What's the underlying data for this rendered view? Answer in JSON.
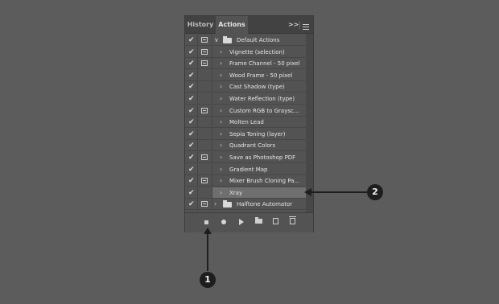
{
  "panel": {
    "tabs": [
      {
        "label": "History",
        "active": false
      },
      {
        "label": "Actions",
        "active": true
      }
    ],
    "expand_label": ">>"
  },
  "actions": [
    {
      "name": "Default Actions",
      "checked": true,
      "dialog": true,
      "type": "folder",
      "expanded": true
    },
    {
      "name": "Vignette (selection)",
      "checked": true,
      "dialog": true,
      "type": "action"
    },
    {
      "name": "Frame Channel - 50 pixel",
      "checked": true,
      "dialog": true,
      "type": "action"
    },
    {
      "name": "Wood Frame - 50 pixel",
      "checked": true,
      "dialog": false,
      "type": "action"
    },
    {
      "name": "Cast Shadow (type)",
      "checked": true,
      "dialog": false,
      "type": "action"
    },
    {
      "name": "Water Reflection (type)",
      "checked": true,
      "dialog": false,
      "type": "action"
    },
    {
      "name": "Custom RGB to Graysc...",
      "checked": true,
      "dialog": true,
      "type": "action"
    },
    {
      "name": "Molten Lead",
      "checked": true,
      "dialog": false,
      "type": "action"
    },
    {
      "name": "Sepia Toning (layer)",
      "checked": true,
      "dialog": false,
      "type": "action"
    },
    {
      "name": "Quadrant Colors",
      "checked": true,
      "dialog": false,
      "type": "action"
    },
    {
      "name": "Save as Photoshop PDF",
      "checked": true,
      "dialog": true,
      "type": "action"
    },
    {
      "name": "Gradient Map",
      "checked": true,
      "dialog": false,
      "type": "action"
    },
    {
      "name": "Mixer Brush Cloning Pa...",
      "checked": true,
      "dialog": true,
      "type": "action"
    },
    {
      "name": "Xray",
      "checked": true,
      "dialog": false,
      "type": "action",
      "selected": true
    },
    {
      "name": "Halftone Automator",
      "checked": true,
      "dialog": true,
      "type": "folder",
      "expanded": false
    }
  ],
  "toolbar": {
    "buttons": [
      "stop-icon",
      "record-icon",
      "play-icon",
      "new-set-icon",
      "new-action-icon",
      "trash-icon"
    ]
  },
  "callouts": {
    "one": "1",
    "two": "2"
  },
  "colors": {
    "background": "#5c5c5c",
    "panel": "#535353",
    "selected_row": "#6f6f6f",
    "callout": "#1e1e1e"
  }
}
